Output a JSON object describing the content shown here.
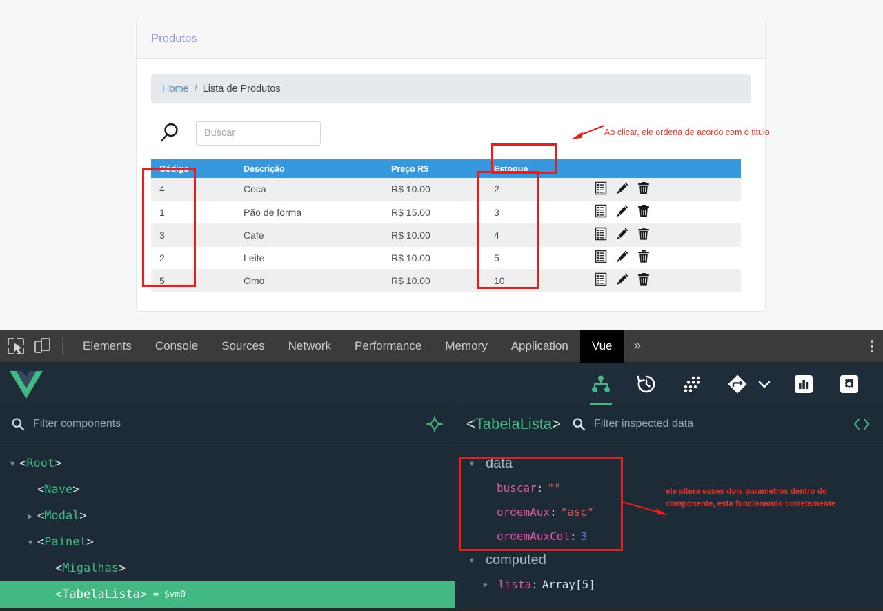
{
  "app": {
    "card_title": "Produtos",
    "breadcrumb": {
      "home": "Home",
      "separator": "/",
      "current": "Lista de Produtos"
    },
    "search": {
      "placeholder": "Buscar",
      "value": "",
      "icon": "search-icon"
    },
    "table": {
      "headers": [
        "Código",
        "Descrição",
        "Preço R$",
        "Estoque",
        ""
      ],
      "rows": [
        {
          "codigo": "4",
          "descricao": "Coca",
          "preco": "R$ 10.00",
          "estoque": "2"
        },
        {
          "codigo": "1",
          "descricao": "Pão de forma",
          "preco": "R$ 15.00",
          "estoque": "3"
        },
        {
          "codigo": "3",
          "descricao": "Café",
          "preco": "R$ 10.00",
          "estoque": "4"
        },
        {
          "codigo": "2",
          "descricao": "Leite",
          "preco": "R$ 10.00",
          "estoque": "5"
        },
        {
          "codigo": "5",
          "descricao": "Omo",
          "preco": "R$ 10.00",
          "estoque": "10"
        }
      ],
      "row_action_icons": [
        "list-details-icon",
        "edit-pencil-icon",
        "delete-trash-icon"
      ],
      "header_color": "#3699e0"
    }
  },
  "annotations": {
    "sort_note": "Ao clicar, ele ordena de acordo com o titulo",
    "data_note_line1": "ele altera esses dois parametros dentro do",
    "data_note_line2": "componente, esta funcionando corretamente",
    "color": "#ee1c18"
  },
  "devtools": {
    "tabs": [
      {
        "label": "Elements",
        "active": false
      },
      {
        "label": "Console",
        "active": false
      },
      {
        "label": "Sources",
        "active": false
      },
      {
        "label": "Network",
        "active": false
      },
      {
        "label": "Performance",
        "active": false
      },
      {
        "label": "Memory",
        "active": false
      },
      {
        "label": "Application",
        "active": false
      },
      {
        "label": "Vue",
        "active": true
      }
    ],
    "more_label": "»",
    "left_icons": [
      "inspect-element-icon",
      "device-toolbar-icon"
    ],
    "kebab": "more-options-icon"
  },
  "vue": {
    "logo": "vue-logo-icon",
    "toolbar_icons": [
      {
        "name": "component-tree-icon",
        "active": true
      },
      {
        "name": "timeline-history-icon",
        "active": false
      },
      {
        "name": "vuex-dots-icon",
        "active": false
      },
      {
        "name": "router-arrow-icon",
        "active": false
      },
      {
        "name": "chevron-down-icon",
        "active": false
      },
      {
        "name": "performance-bars-icon",
        "active": false
      },
      {
        "name": "settings-gear-icon",
        "active": false
      }
    ],
    "filter_components": {
      "placeholder": "Filter components",
      "value": "",
      "icon": "search-icon",
      "target_icon": "select-component-target-icon"
    },
    "inspected": {
      "component_name": "TabelaLista",
      "bracket_open": "<",
      "bracket_close": ">",
      "filter_placeholder": "Filter inspected data",
      "value": "",
      "code_icon": "angle-brackets-icon"
    },
    "tree": [
      {
        "name": "Root",
        "indent": 0,
        "caret": "open",
        "selected": false,
        "vm": ""
      },
      {
        "name": "Nave",
        "indent": 1,
        "caret": "none",
        "selected": false,
        "vm": ""
      },
      {
        "name": "Modal",
        "indent": 1,
        "caret": "closed",
        "selected": false,
        "vm": ""
      },
      {
        "name": "Painel",
        "indent": 1,
        "caret": "open",
        "selected": false,
        "vm": ""
      },
      {
        "name": "Migalhas",
        "indent": 2,
        "caret": "none",
        "selected": false,
        "vm": ""
      },
      {
        "name": "TabelaLista",
        "indent": 2,
        "caret": "none",
        "selected": true,
        "vm": "= $vm0"
      }
    ],
    "data_section": {
      "title": "data",
      "fields": [
        {
          "key": "buscar",
          "sep": ":",
          "value": "\"\"",
          "type": "string"
        },
        {
          "key": "ordemAux",
          "sep": ":",
          "value": "\"asc\"",
          "type": "string"
        },
        {
          "key": "ordemAuxCol",
          "sep": ":",
          "value": "3",
          "type": "number"
        }
      ]
    },
    "computed_section": {
      "title": "computed",
      "fields": [
        {
          "key": "lista",
          "sep": ":",
          "value": "Array[5]",
          "type": "plain"
        }
      ]
    }
  }
}
